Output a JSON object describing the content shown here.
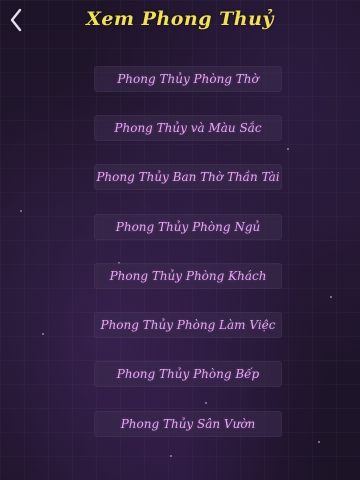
{
  "header": {
    "title": "Xem Phong Thuỷ",
    "back_icon": "chevron-left-icon"
  },
  "colors": {
    "title": "#f1e24a",
    "menu_text": "#e6a6f2",
    "background": "#1e1429"
  },
  "menu": {
    "items": [
      {
        "label": "Phong Thủy Phòng Thờ"
      },
      {
        "label": "Phong Thủy và Màu Sắc"
      },
      {
        "label": "Phong Thủy Ban Thờ Thần Tài"
      },
      {
        "label": "Phong Thủy Phòng Ngủ"
      },
      {
        "label": "Phong Thủy Phòng Khách"
      },
      {
        "label": "Phong Thủy Phòng Làm Việc"
      },
      {
        "label": "Phong Thủy Phòng Bếp"
      },
      {
        "label": "Phong Thủy Sân Vườn"
      }
    ]
  }
}
